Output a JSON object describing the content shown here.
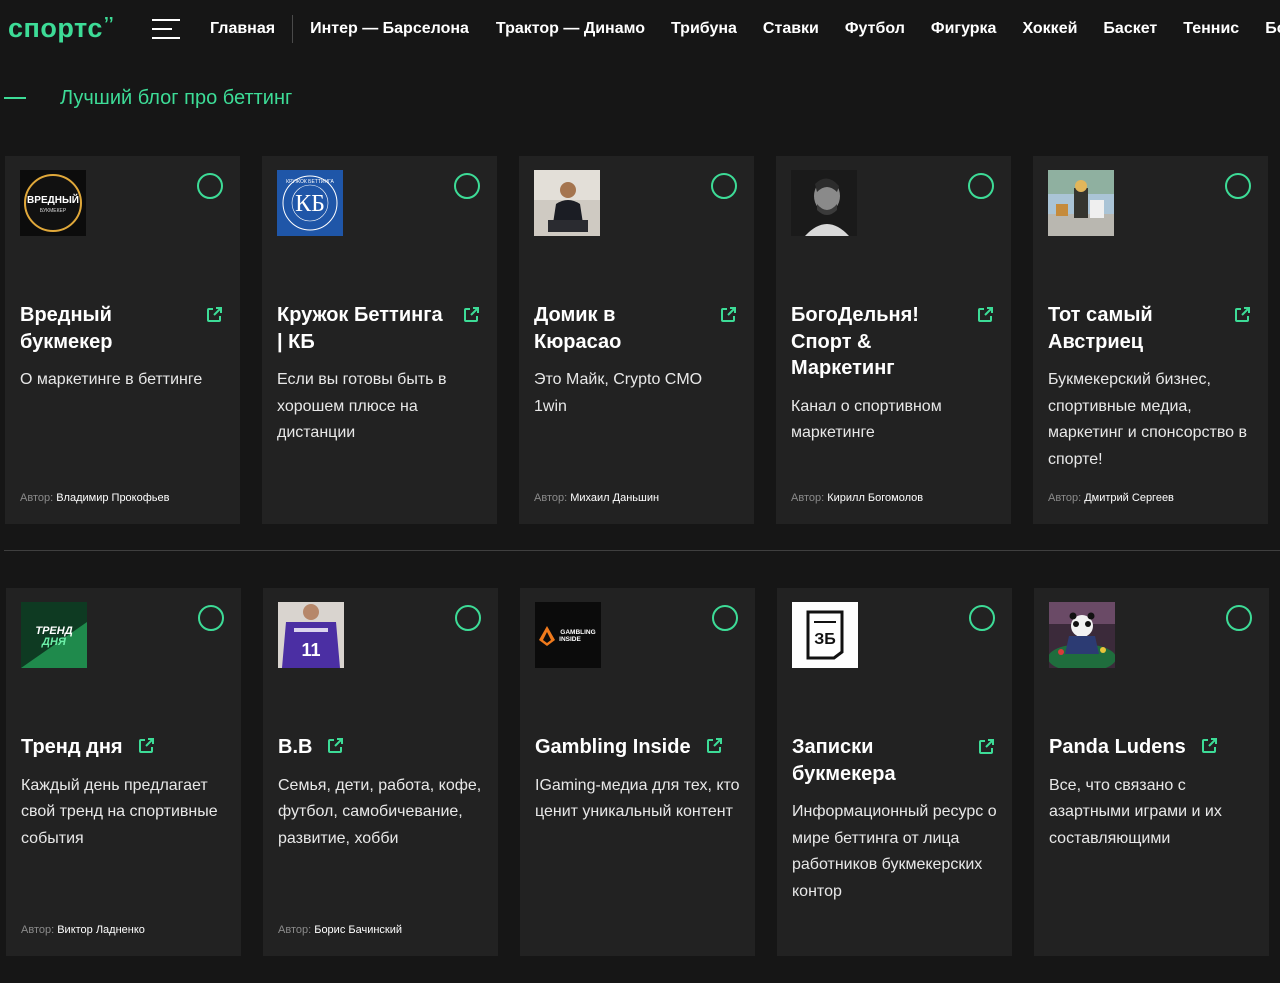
{
  "header": {
    "logo": "спортс",
    "logo_ticks": "’’",
    "nav": [
      "Главная",
      "Интер — Барселона",
      "Трактор — Динамо",
      "Трибуна",
      "Ставки",
      "Футбол",
      "Фигурка",
      "Хоккей",
      "Баскет",
      "Теннис",
      "Бокс"
    ]
  },
  "section": {
    "title": "Лучший блог про беттинг"
  },
  "author_prefix": "Автор:",
  "cards": [
    {
      "name": "Вредный букмекер",
      "desc": "О маркетинге в беттинге",
      "author": "Владимир Прокофьев",
      "avatar_icon": "vredny-bukmeker-logo",
      "logo_text": "ВРЕДНЫЙ",
      "logo_subtext": "БУКМЕКЕР"
    },
    {
      "name": "Кружок Беттинга | КБ",
      "desc": "Если вы готовы быть в хорошем плюсе на дистанции",
      "author": "",
      "avatar_icon": "kruzhok-bettinga-logo",
      "logo_text": "КБ",
      "logo_ring_text": "КРУЖОК БЕТТИНГА"
    },
    {
      "name": "Домик в Кюрасао",
      "desc": "Это Майк, Crypto CMO 1win",
      "author": "Михаил Даньшин",
      "avatar_icon": "person-photo"
    },
    {
      "name": "БогоДельня! Спорт & Маркетинг",
      "desc": "Канал о спортивном маркетинге",
      "author": "Кирилл Богомолов",
      "avatar_icon": "person-photo-bw"
    },
    {
      "name": "Тот самый Австриец",
      "desc": "Букмекерский бизнес, спортивные медиа, маркетинг и спонсорство в спорте!",
      "author": "Дмитрий Сергеев",
      "avatar_icon": "figurine-photo"
    },
    {
      "name": "Тренд дня",
      "desc": "Каждый день предлагает свой тренд на спортивные события",
      "author": "Виктор Ладненко",
      "avatar_icon": "trend-dnya-logo",
      "logo_text": "ТРЕНД",
      "logo_subtext": "ДНЯ"
    },
    {
      "name": "B.B",
      "desc": "Семья, дети, работа, кофе, футбол, самобичевание, развитие, хобби",
      "author": "Борис Бачинский",
      "avatar_icon": "jersey-photo",
      "logo_text": "11"
    },
    {
      "name": "Gambling Inside",
      "desc": "IGaming-медиа для тех, кто ценит уникальный контент",
      "author": "",
      "avatar_icon": "gambling-inside-logo",
      "logo_text": "GAMBLING",
      "logo_subtext": "INSIDE"
    },
    {
      "name": "Записки букмекера",
      "desc": "Информационный ресурс о мире беттинга от лица работников букмекерских контор",
      "author": "",
      "avatar_icon": "zapiski-bukmekera-logo",
      "logo_text": "ЗБ"
    },
    {
      "name": "Panda Ludens",
      "desc": "Все, что связано с азартными играми и их составляющими",
      "author": "",
      "avatar_icon": "panda-casino-photo"
    }
  ],
  "colors": {
    "accent": "#3ddc97",
    "background": "#161616",
    "card": "#222222",
    "muted": "#8b8b8b"
  }
}
